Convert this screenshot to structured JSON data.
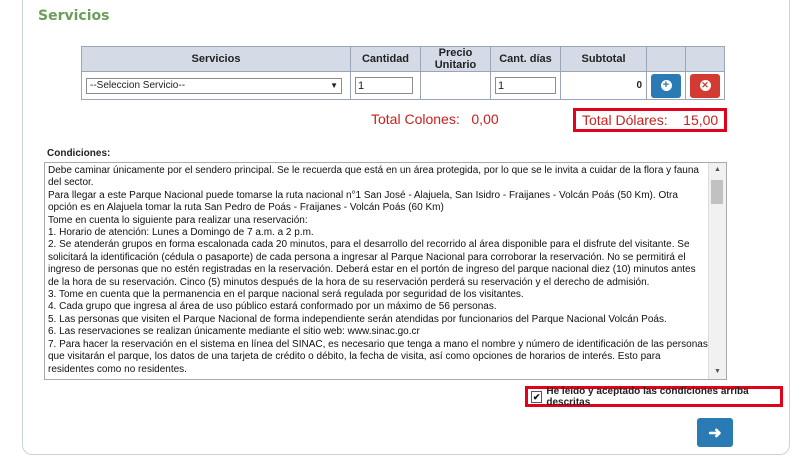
{
  "section": {
    "title": "Servicios"
  },
  "table": {
    "headers": [
      "Servicios",
      "Cantidad",
      "Precio Unitario",
      "Cant. días",
      "Subtotal"
    ],
    "row": {
      "service_select": "--Seleccion Servicio--",
      "cantidad": "1",
      "precio_unitario": "",
      "cant_dias": "1",
      "subtotal": "0"
    }
  },
  "totals": {
    "colones_label": "Total Colones:",
    "colones_value": "0,00",
    "dolares_label": "Total Dólares:",
    "dolares_value": "15,00"
  },
  "conditions": {
    "label": "Condiciones:",
    "paragraphs": [
      "Debe caminar únicamente por el sendero principal. Se le recuerda que está en un área protegida, por lo que se le invita a cuidar de la flora y fauna del sector.",
      "Para llegar a este Parque Nacional puede tomarse la ruta nacional n°1 San José - Alajuela, San Isidro - Fraijanes - Volcán Poás (50 Km).  Otra opción es en Alajuela tomar la ruta San Pedro de Poás - Fraijanes - Volcán Poás (60 Km)",
      " Tome en cuenta lo siguiente para realizar una reservación:",
      "1. Horario de atención: Lunes a Domingo de 7 a.m. a 2 p.m.",
      "2. Se atenderán grupos en forma escalonada cada 20 minutos, para el desarrollo del recorrido al área disponible para el disfrute del visitante. Se solicitará la identificación (cédula o pasaporte) de cada persona a ingresar al Parque Nacional para corroborar la reservación. No se permitirá el ingreso de personas que no estén registradas en la reservación. Deberá estar en el portón de ingreso del parque nacional diez (10) minutos antes de la hora de su reservación. Cinco (5) minutos después de la hora de su reservación perderá su reservación y el derecho de admisión.",
      "3. Tome en cuenta que la permanencia en el parque nacional será regulada por seguridad de los visitantes.",
      "4. Cada grupo que ingresa al área de uso público estará conformado por un máximo de 56 personas.",
      "5. Las personas que visiten el Parque Nacional de forma independiente serán atendidas por funcionarios del Parque Nacional Volcán Poás.",
      "6. Las reservaciones se realizan únicamente mediante el sitio web:  www.sinac.go.cr",
      "7. Para hacer la reservación en el sistema en línea del SINAC, es necesario que tenga a mano el nombre y número de identificación de las personas que visitarán el parque, los datos de una tarjeta de crédito o débito, la fecha de visita, así como opciones de horarios de interés. Esto para residentes como no residentes."
    ]
  },
  "accept": {
    "checkbox_checked": true,
    "checkmark": "✔",
    "label": "He leído y aceptado las condiciones arriba descritas"
  },
  "icons": {
    "select_arrow": "▼",
    "add": "+",
    "remove": "✕",
    "next": "➜",
    "scroll_up": "▲",
    "scroll_down": "▼"
  },
  "colors": {
    "accent": "#2a7ab3",
    "danger": "#d23a32",
    "total_red": "#c8201e",
    "title_green": "#6a9e5a"
  }
}
